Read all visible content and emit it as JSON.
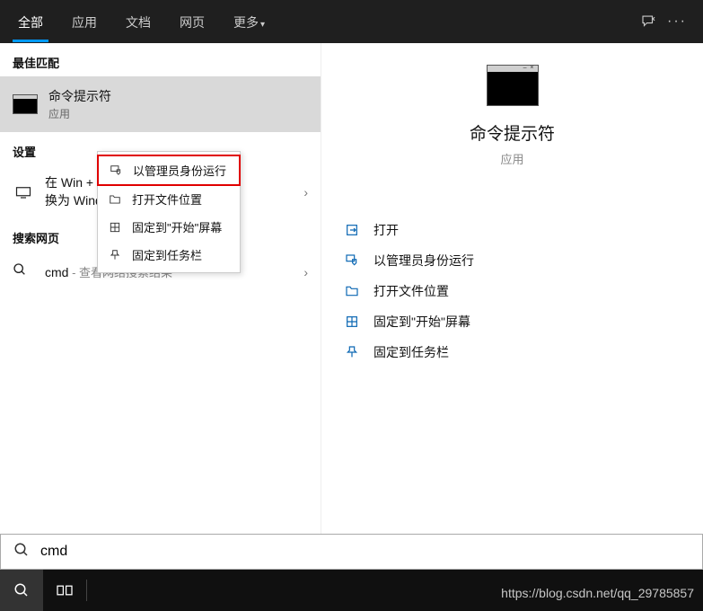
{
  "tabs": {
    "all": "全部",
    "apps": "应用",
    "docs": "文档",
    "web": "网页",
    "more": "更多"
  },
  "sections": {
    "best_match": "最佳匹配",
    "settings": "设置",
    "search_web": "搜索网页"
  },
  "best_match": {
    "title": "命令提示符",
    "subtitle": "应用"
  },
  "setting_item": {
    "line1": "在 Win + ",
    "line2": "换为 Wind"
  },
  "web": {
    "query": "cmd",
    "hint": " - 查看网络搜索结果"
  },
  "context_menu": {
    "run_admin": "以管理员身份运行",
    "open_location": "打开文件位置",
    "pin_start": "固定到\"开始\"屏幕",
    "pin_taskbar": "固定到任务栏"
  },
  "preview": {
    "title": "命令提示符",
    "subtitle": "应用"
  },
  "actions": {
    "open": "打开",
    "run_admin": "以管理员身份运行",
    "open_location": "打开文件位置",
    "pin_start": "固定到\"开始\"屏幕",
    "pin_taskbar": "固定到任务栏"
  },
  "search_input": "cmd",
  "watermark": "https://blog.csdn.net/qq_29785857"
}
